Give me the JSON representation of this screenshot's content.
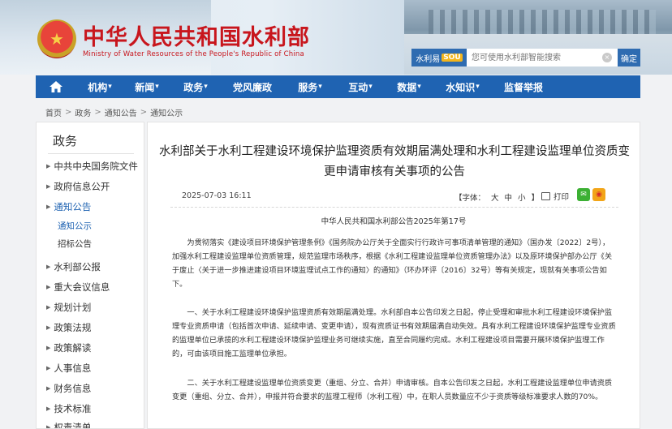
{
  "header": {
    "title": "中华人民共和国水利部",
    "subtitle": "Ministry of Water Resources of the People's Republic of China",
    "search": {
      "brand_label": "水利易",
      "brand_badge": "SOU",
      "placeholder": "您可使用水利部智能搜索",
      "submit_label": "确定"
    }
  },
  "nav": {
    "items": [
      {
        "label": "机构",
        "dropdown": true
      },
      {
        "label": "新闻",
        "dropdown": true
      },
      {
        "label": "政务",
        "dropdown": true
      },
      {
        "label": "党风廉政",
        "dropdown": false
      },
      {
        "label": "服务",
        "dropdown": true
      },
      {
        "label": "互动",
        "dropdown": true
      },
      {
        "label": "数据",
        "dropdown": true
      },
      {
        "label": "水知识",
        "dropdown": true
      },
      {
        "label": "监督举报",
        "dropdown": false
      }
    ]
  },
  "breadcrumb": {
    "items": [
      "首页",
      "政务",
      "通知公告",
      "通知公示"
    ],
    "separator": ">"
  },
  "sidebar": {
    "title": "政务",
    "items": [
      {
        "label": "中共中央国务院文件"
      },
      {
        "label": "政府信息公开"
      },
      {
        "label": "通知公告"
      },
      {
        "label": "通知公示"
      },
      {
        "label": "招标公告"
      },
      {
        "label": "水利部公报"
      },
      {
        "label": "重大会议信息"
      },
      {
        "label": "规划计划"
      },
      {
        "label": "政策法规"
      },
      {
        "label": "政策解读"
      },
      {
        "label": "人事信息"
      },
      {
        "label": "财务信息"
      },
      {
        "label": "技术标准"
      },
      {
        "label": "权责清单"
      }
    ]
  },
  "article": {
    "title": "水利部关于水利工程建设环境保护监理资质有效期届满处理和水利工程建设监理单位资质变更申请审核有关事项的公告",
    "date": "2025-07-03 16:11",
    "font_label": "【字体：",
    "font_large": "大",
    "font_medium": "中",
    "font_small": "小",
    "font_close": "】",
    "print_label": "打印",
    "doc_number": "中华人民共和国水利部公告2025年第17号",
    "paragraphs": [
      "为贯彻落实《建设项目环境保护管理条例》《国务院办公厅关于全面实行行政许可事项清单管理的通知》（国办发〔2022〕2号），加强水利工程建设监理单位资质管理，规范监理市场秩序，根据《水利工程建设监理单位资质管理办法》以及原环境保护部办公厅《关于废止〈关于进一步推进建设项目环境监理试点工作的通知〉的通知》（环办环评〔2016〕32号）等有关规定，现就有关事项公告如下。",
      "一、关于水利工程建设环境保护监理资质有效期届满处理。水利部自本公告印发之日起，停止受理和审批水利工程建设环境保护监理专业资质申请（包括首次申请、延续申请、变更申请），现有资质证书有效期届满自动失效。具有水利工程建设环境保护监理专业资质的监理单位已承揽的水利工程建设环境保护监理业务可继续实施，直至合同履约完成。水利工程建设项目需要开展环境保护监理工作的，可由该项目施工监理单位承担。",
      "二、关于水利工程建设监理单位资质变更（重组、分立、合并）申请审核。自本公告印发之日起，水利工程建设监理单位申请资质变更（重组、分立、合并），申报并符合要求的监理工程师（水利工程）中，在职人员数量应不少于资质等级标准要求人数的70%。"
    ]
  },
  "colors": {
    "brand_red": "#c8161d",
    "nav_blue": "#1f63b2",
    "active_link": "#1f63b2",
    "sou_badge": "#f3b51c"
  },
  "icons": [
    "home-icon",
    "search-clear-icon",
    "print-icon",
    "wechat-icon",
    "weibo-icon",
    "national-emblem-icon"
  ]
}
